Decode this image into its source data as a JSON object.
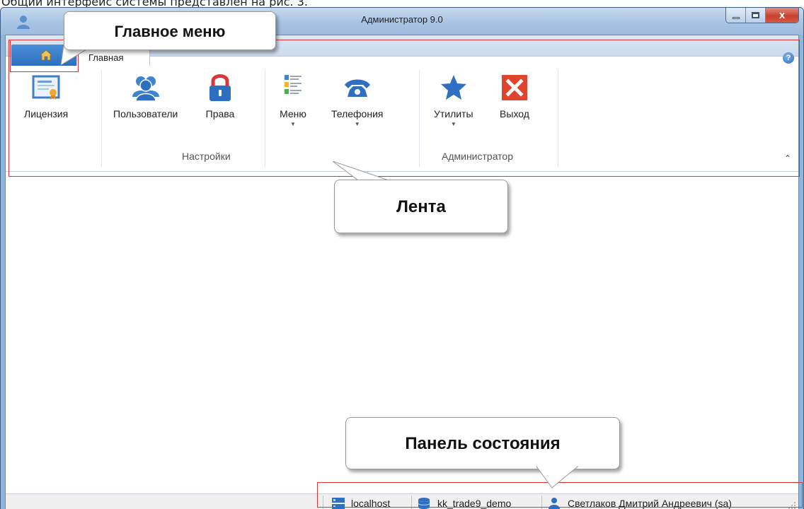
{
  "caption_top": "Общий интерфейс системы представлен на рис. 3.",
  "window": {
    "title": "Администратор 9.0",
    "close_glyph": "x"
  },
  "ribbon": {
    "tab_label": "Главная",
    "help_glyph": "?",
    "buttons": [
      {
        "label": "Лицензия",
        "icon": "license-icon"
      },
      {
        "label": "Пользователи",
        "icon": "users-icon"
      },
      {
        "label": "Права",
        "icon": "lock-icon"
      },
      {
        "label": "Меню",
        "icon": "menu-icon",
        "has_dropdown": true
      },
      {
        "label": "Телефония",
        "icon": "phone-icon",
        "has_dropdown": true
      },
      {
        "label": "Утилиты",
        "icon": "star-icon",
        "has_dropdown": true
      },
      {
        "label": "Выход",
        "icon": "exit-icon"
      }
    ],
    "groups": [
      {
        "label": "Настройки"
      },
      {
        "label": "Администратор"
      }
    ],
    "collapse_glyph": "⌃"
  },
  "statusbar": {
    "server": "localhost",
    "database": "kk_trade9_demo",
    "user": "Светлаков Дмитрий Андреевич (sa)"
  },
  "annotations": {
    "main_menu": "Главное меню",
    "ribbon": "Лента",
    "status_panel": "Панель состояния"
  },
  "colors": {
    "highlight": "#e23232",
    "home_tab": "#2d6fbf",
    "close_button": "#c7412d",
    "accent_blue": "#2f6fc2"
  }
}
